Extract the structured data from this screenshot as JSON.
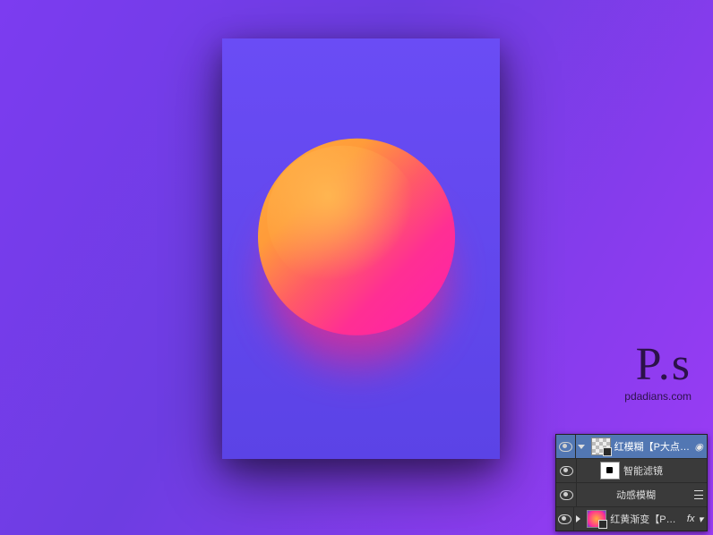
{
  "watermark": {
    "logo_text": "P.s",
    "url": "pdadians.com"
  },
  "layers_panel": {
    "rows": [
      {
        "kind": "smart-object",
        "label": "红模糊【P大点S】",
        "selected": true,
        "visible": true,
        "expanded": true,
        "thumb": "transparency",
        "right_icon": "options"
      },
      {
        "kind": "filter-group",
        "label": "智能滤镜",
        "visible": true,
        "indent": 1,
        "thumb": "mask"
      },
      {
        "kind": "filter",
        "label": "动感模糊",
        "visible": true,
        "indent": 2,
        "right_icon": "filter-settings"
      },
      {
        "kind": "smart-object",
        "label": "红黄渐变【P大点...",
        "visible": true,
        "expanded": false,
        "thumb": "orbthumb",
        "fx": "fx"
      }
    ]
  }
}
